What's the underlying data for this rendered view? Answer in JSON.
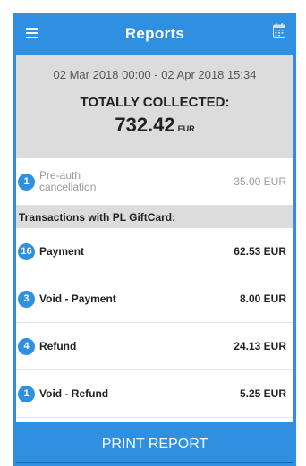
{
  "header": {
    "title": "Reports"
  },
  "summary": {
    "date_range": "02 Mar 2018 00:00 - 02 Apr 2018 15:34",
    "collected_label": "TOTALLY COLLECTED:",
    "amount": "732.42",
    "currency": "EUR"
  },
  "preauth": {
    "count": "1",
    "label": "Pre-auth cancellation",
    "value": "35.00 EUR"
  },
  "section_title": "Transactions with PL GiftCard:",
  "transactions": [
    {
      "count": "16",
      "label": "Payment",
      "value": "62.53 EUR"
    },
    {
      "count": "3",
      "label": "Void - Payment",
      "value": "8.00 EUR"
    },
    {
      "count": "4",
      "label": "Refund",
      "value": "24.13 EUR"
    },
    {
      "count": "1",
      "label": "Void - Refund",
      "value": "5.25 EUR"
    }
  ],
  "footer": {
    "print_label": "PRINT REPORT"
  },
  "colors": {
    "accent": "#2f8fe0",
    "summary_bg": "#dcdcdc"
  },
  "icons": {
    "menu": "hamburger-menu-icon",
    "calendar": "calendar-icon"
  }
}
